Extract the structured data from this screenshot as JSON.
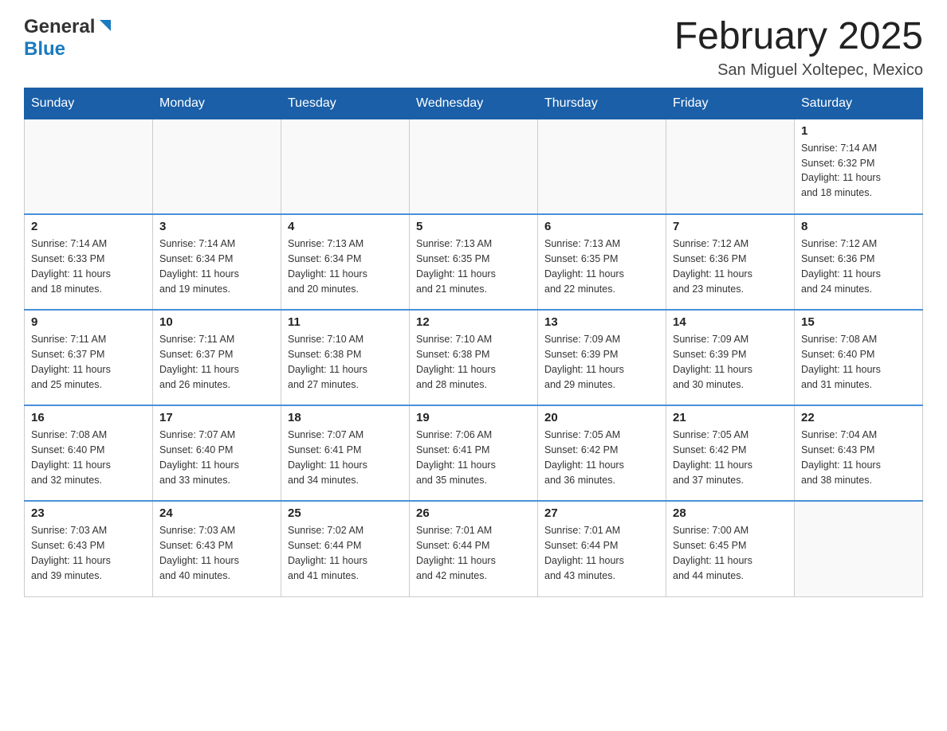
{
  "header": {
    "logo_general": "General",
    "logo_blue": "Blue",
    "month_title": "February 2025",
    "location": "San Miguel Xoltepec, Mexico"
  },
  "weekdays": [
    "Sunday",
    "Monday",
    "Tuesday",
    "Wednesday",
    "Thursday",
    "Friday",
    "Saturday"
  ],
  "weeks": [
    [
      {
        "day": "",
        "info": ""
      },
      {
        "day": "",
        "info": ""
      },
      {
        "day": "",
        "info": ""
      },
      {
        "day": "",
        "info": ""
      },
      {
        "day": "",
        "info": ""
      },
      {
        "day": "",
        "info": ""
      },
      {
        "day": "1",
        "info": "Sunrise: 7:14 AM\nSunset: 6:32 PM\nDaylight: 11 hours\nand 18 minutes."
      }
    ],
    [
      {
        "day": "2",
        "info": "Sunrise: 7:14 AM\nSunset: 6:33 PM\nDaylight: 11 hours\nand 18 minutes."
      },
      {
        "day": "3",
        "info": "Sunrise: 7:14 AM\nSunset: 6:34 PM\nDaylight: 11 hours\nand 19 minutes."
      },
      {
        "day": "4",
        "info": "Sunrise: 7:13 AM\nSunset: 6:34 PM\nDaylight: 11 hours\nand 20 minutes."
      },
      {
        "day": "5",
        "info": "Sunrise: 7:13 AM\nSunset: 6:35 PM\nDaylight: 11 hours\nand 21 minutes."
      },
      {
        "day": "6",
        "info": "Sunrise: 7:13 AM\nSunset: 6:35 PM\nDaylight: 11 hours\nand 22 minutes."
      },
      {
        "day": "7",
        "info": "Sunrise: 7:12 AM\nSunset: 6:36 PM\nDaylight: 11 hours\nand 23 minutes."
      },
      {
        "day": "8",
        "info": "Sunrise: 7:12 AM\nSunset: 6:36 PM\nDaylight: 11 hours\nand 24 minutes."
      }
    ],
    [
      {
        "day": "9",
        "info": "Sunrise: 7:11 AM\nSunset: 6:37 PM\nDaylight: 11 hours\nand 25 minutes."
      },
      {
        "day": "10",
        "info": "Sunrise: 7:11 AM\nSunset: 6:37 PM\nDaylight: 11 hours\nand 26 minutes."
      },
      {
        "day": "11",
        "info": "Sunrise: 7:10 AM\nSunset: 6:38 PM\nDaylight: 11 hours\nand 27 minutes."
      },
      {
        "day": "12",
        "info": "Sunrise: 7:10 AM\nSunset: 6:38 PM\nDaylight: 11 hours\nand 28 minutes."
      },
      {
        "day": "13",
        "info": "Sunrise: 7:09 AM\nSunset: 6:39 PM\nDaylight: 11 hours\nand 29 minutes."
      },
      {
        "day": "14",
        "info": "Sunrise: 7:09 AM\nSunset: 6:39 PM\nDaylight: 11 hours\nand 30 minutes."
      },
      {
        "day": "15",
        "info": "Sunrise: 7:08 AM\nSunset: 6:40 PM\nDaylight: 11 hours\nand 31 minutes."
      }
    ],
    [
      {
        "day": "16",
        "info": "Sunrise: 7:08 AM\nSunset: 6:40 PM\nDaylight: 11 hours\nand 32 minutes."
      },
      {
        "day": "17",
        "info": "Sunrise: 7:07 AM\nSunset: 6:40 PM\nDaylight: 11 hours\nand 33 minutes."
      },
      {
        "day": "18",
        "info": "Sunrise: 7:07 AM\nSunset: 6:41 PM\nDaylight: 11 hours\nand 34 minutes."
      },
      {
        "day": "19",
        "info": "Sunrise: 7:06 AM\nSunset: 6:41 PM\nDaylight: 11 hours\nand 35 minutes."
      },
      {
        "day": "20",
        "info": "Sunrise: 7:05 AM\nSunset: 6:42 PM\nDaylight: 11 hours\nand 36 minutes."
      },
      {
        "day": "21",
        "info": "Sunrise: 7:05 AM\nSunset: 6:42 PM\nDaylight: 11 hours\nand 37 minutes."
      },
      {
        "day": "22",
        "info": "Sunrise: 7:04 AM\nSunset: 6:43 PM\nDaylight: 11 hours\nand 38 minutes."
      }
    ],
    [
      {
        "day": "23",
        "info": "Sunrise: 7:03 AM\nSunset: 6:43 PM\nDaylight: 11 hours\nand 39 minutes."
      },
      {
        "day": "24",
        "info": "Sunrise: 7:03 AM\nSunset: 6:43 PM\nDaylight: 11 hours\nand 40 minutes."
      },
      {
        "day": "25",
        "info": "Sunrise: 7:02 AM\nSunset: 6:44 PM\nDaylight: 11 hours\nand 41 minutes."
      },
      {
        "day": "26",
        "info": "Sunrise: 7:01 AM\nSunset: 6:44 PM\nDaylight: 11 hours\nand 42 minutes."
      },
      {
        "day": "27",
        "info": "Sunrise: 7:01 AM\nSunset: 6:44 PM\nDaylight: 11 hours\nand 43 minutes."
      },
      {
        "day": "28",
        "info": "Sunrise: 7:00 AM\nSunset: 6:45 PM\nDaylight: 11 hours\nand 44 minutes."
      },
      {
        "day": "",
        "info": ""
      }
    ]
  ],
  "colors": {
    "header_bg": "#1a5fa8",
    "header_text": "#ffffff",
    "border_color": "#cccccc",
    "row_separator": "#4a90d9"
  }
}
